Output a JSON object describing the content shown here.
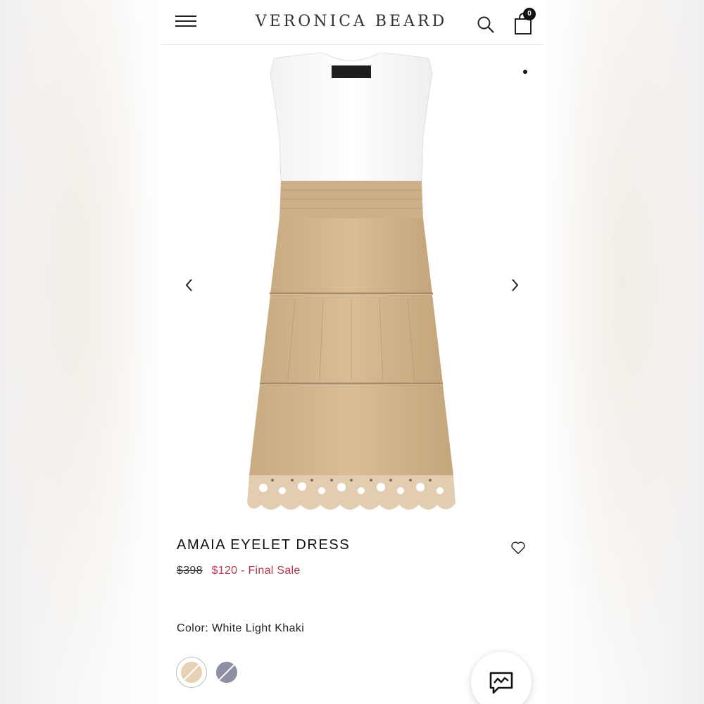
{
  "header": {
    "brand": "VERONICA BEARD",
    "bag_count": "0",
    "icons": [
      "hamburger-menu-icon",
      "search-icon",
      "shopping-bag-icon"
    ]
  },
  "gallery": {
    "icons": [
      "chevron-left-icon",
      "chevron-right-icon"
    ]
  },
  "product": {
    "name": "AMAIA EYELET DRESS",
    "original_price": "$398",
    "sale_price": "$120 - Final Sale",
    "color_prefix": "Color:",
    "color_name": "White Light Khaki"
  },
  "swatches": [
    {
      "name": "White Light Khaki",
      "color": "#e8d2b6",
      "selected": true
    },
    {
      "name": "Gray",
      "color": "#8e8fa3",
      "selected": false
    }
  ],
  "colors": {
    "sale": "#b5344a",
    "dress_top": "#ffffff",
    "dress_skirt": "#d6b98f"
  }
}
